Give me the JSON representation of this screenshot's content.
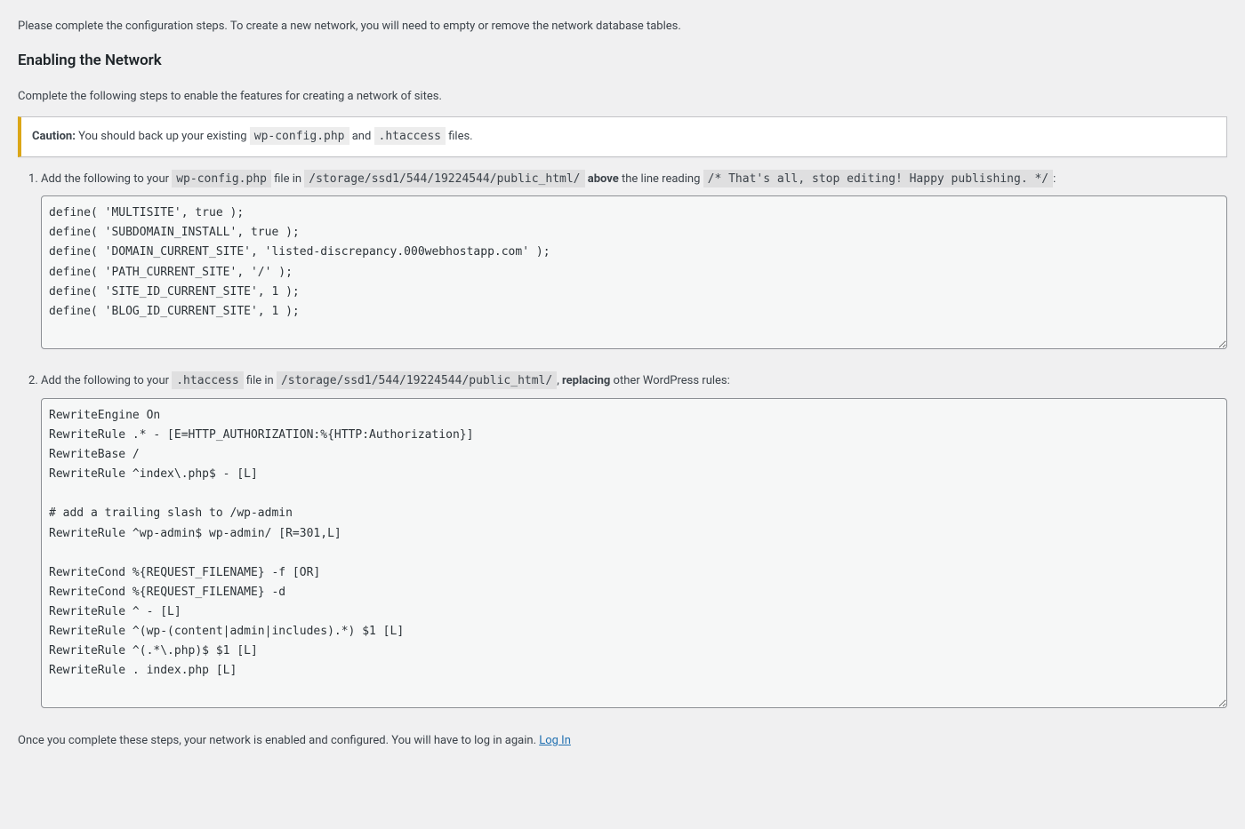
{
  "intro": "Please complete the configuration steps. To create a new network, you will need to empty or remove the network database tables.",
  "heading": "Enabling the Network",
  "subtitle": "Complete the following steps to enable the features for creating a network of sites.",
  "notice": {
    "caution_label": "Caution:",
    "text1": " You should back up your existing ",
    "code1": "wp-config.php",
    "text2": " and ",
    "code2": ".htaccess",
    "text3": " files."
  },
  "step1": {
    "text1": "Add the following to your ",
    "code_file": "wp-config.php",
    "text2": " file in ",
    "code_path": "/storage/ssd1/544/19224544/public_html/",
    "text3": " ",
    "bold1": "above",
    "text4": " the line reading ",
    "code_line": "/* That's all, stop editing! Happy publishing. */",
    "text5": ":",
    "textarea": "define( 'MULTISITE', true );\ndefine( 'SUBDOMAIN_INSTALL', true );\ndefine( 'DOMAIN_CURRENT_SITE', 'listed-discrepancy.000webhostapp.com' );\ndefine( 'PATH_CURRENT_SITE', '/' );\ndefine( 'SITE_ID_CURRENT_SITE', 1 );\ndefine( 'BLOG_ID_CURRENT_SITE', 1 );"
  },
  "step2": {
    "text1": "Add the following to your ",
    "code_file": ".htaccess",
    "text2": " file in ",
    "code_path": "/storage/ssd1/544/19224544/public_html/",
    "text3": ", ",
    "bold1": "replacing",
    "text4": " other WordPress rules:",
    "textarea": "RewriteEngine On\nRewriteRule .* - [E=HTTP_AUTHORIZATION:%{HTTP:Authorization}]\nRewriteBase /\nRewriteRule ^index\\.php$ - [L]\n\n# add a trailing slash to /wp-admin\nRewriteRule ^wp-admin$ wp-admin/ [R=301,L]\n\nRewriteCond %{REQUEST_FILENAME} -f [OR]\nRewriteCond %{REQUEST_FILENAME} -d\nRewriteRule ^ - [L]\nRewriteRule ^(wp-(content|admin|includes).*) $1 [L]\nRewriteRule ^(.*\\.php)$ $1 [L]\nRewriteRule . index.php [L]"
  },
  "closing": {
    "text": "Once you complete these steps, your network is enabled and configured. You will have to log in again. ",
    "link_label": "Log In"
  }
}
